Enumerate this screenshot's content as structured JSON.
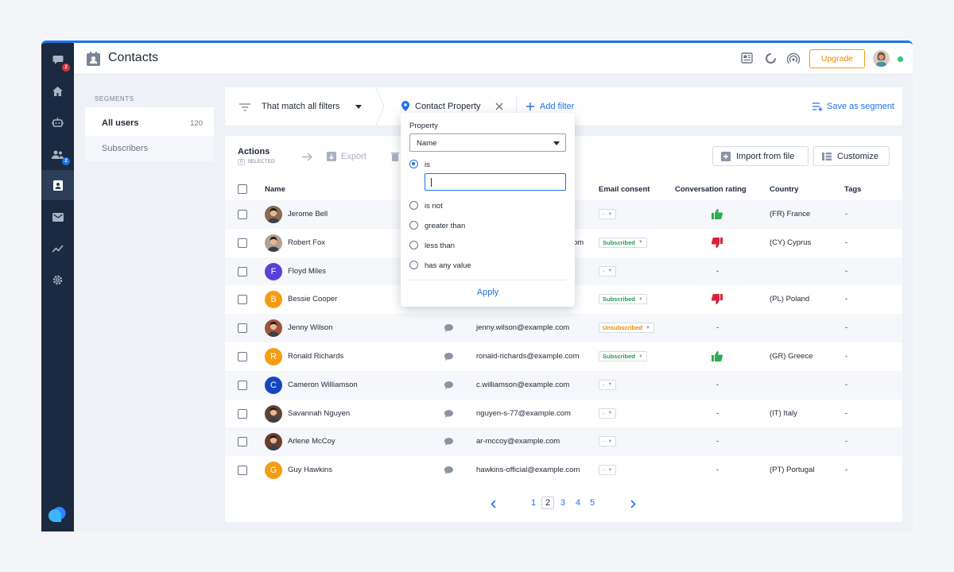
{
  "app": {
    "title": "Contacts",
    "upgrade_label": "Upgrade",
    "accent": "#1e73e8",
    "sidebar_badges": {
      "chat": "2",
      "team": "2"
    }
  },
  "segments": {
    "heading": "SEGMENTS",
    "items": [
      {
        "label": "All users",
        "count": "120"
      },
      {
        "label": "Subscribers",
        "count": ""
      }
    ]
  },
  "filters": {
    "match_label": "That match all filters",
    "property_chip": "Contact Property",
    "add_filter": "Add filter",
    "save_segment": "Save as segment"
  },
  "actions": {
    "title": "Actions",
    "selected_count": "0",
    "selected_label": "SELECTED",
    "export_label": "Export",
    "import_label": "Import from file",
    "customize_label": "Customize"
  },
  "table": {
    "headers": {
      "name": "Name",
      "email_consent": "Email consent",
      "conversation_rating": "Conversation rating",
      "country": "Country",
      "tags": "Tags"
    },
    "rows": [
      {
        "name": "Jerome Bell",
        "initial": "",
        "avatar_color": "#8a6a55",
        "email": "",
        "consent": "-",
        "consent_type": "none",
        "rating": "up",
        "country": "(FR) France",
        "tags": "-"
      },
      {
        "name": "Robert Fox",
        "initial": "",
        "avatar_color": "#b0a393",
        "email": "om",
        "consent": "Subscribed",
        "consent_type": "sub",
        "rating": "down",
        "country": "(CY) Cyprus",
        "tags": "-"
      },
      {
        "name": "Floyd Miles",
        "initial": "F",
        "avatar_color": "#5b3fd6",
        "email": "",
        "consent": "-",
        "consent_type": "none",
        "rating": "-",
        "country": "",
        "tags": "-"
      },
      {
        "name": "Bessie Cooper",
        "initial": "B",
        "avatar_color": "#f59b14",
        "email": "",
        "consent": "Subscribed",
        "consent_type": "sub",
        "rating": "down",
        "country": "(PL) Poland",
        "tags": "-"
      },
      {
        "name": "Jenny Wilson",
        "initial": "",
        "avatar_color": "#a0523a",
        "email": "jenny.wilson@example.com",
        "consent": "Unsubscribed",
        "consent_type": "unsub",
        "rating": "-",
        "country": "",
        "tags": "-"
      },
      {
        "name": "Ronald Richards",
        "initial": "R",
        "avatar_color": "#f59b14",
        "email": "ronald-richards@example.com",
        "consent": "Subscribed",
        "consent_type": "sub",
        "rating": "up",
        "country": "(GR) Greece",
        "tags": "-"
      },
      {
        "name": "Cameron Williamson",
        "initial": "C",
        "avatar_color": "#1546c2",
        "email": "c.williamson@example.com",
        "consent": "-",
        "consent_type": "none",
        "rating": "-",
        "country": "",
        "tags": "-"
      },
      {
        "name": "Savannah Nguyen",
        "initial": "",
        "avatar_color": "#5e4536",
        "email": "nguyen-s-77@example.com",
        "consent": "-",
        "consent_type": "none",
        "rating": "-",
        "country": "(IT) Italy",
        "tags": "-"
      },
      {
        "name": "Arlene McCoy",
        "initial": "",
        "avatar_color": "#6b3d2e",
        "email": "ar-mccoy@example.com",
        "consent": "-",
        "consent_type": "none",
        "rating": "-",
        "country": "",
        "tags": "-"
      },
      {
        "name": "Guy Hawkins",
        "initial": "G",
        "avatar_color": "#f59b14",
        "email": "hawkins-official@example.com",
        "consent": "-",
        "consent_type": "none",
        "rating": "-",
        "country": "(PT) Portugal",
        "tags": "-"
      }
    ]
  },
  "pagination": {
    "pages": [
      "1",
      "2",
      "3",
      "4",
      "5"
    ],
    "current": "2"
  },
  "popover": {
    "property_label": "Property",
    "property_value": "Name",
    "input_value": "",
    "options": [
      "is",
      "is not",
      "greater than",
      "less than",
      "has any value"
    ],
    "selected_option": "is",
    "apply_label": "Apply"
  },
  "colors": {
    "subscribed": "#1f9d4c",
    "unsubscribed": "#e88a00",
    "thumb_up": "#2eab55",
    "thumb_down": "#d8223b"
  }
}
